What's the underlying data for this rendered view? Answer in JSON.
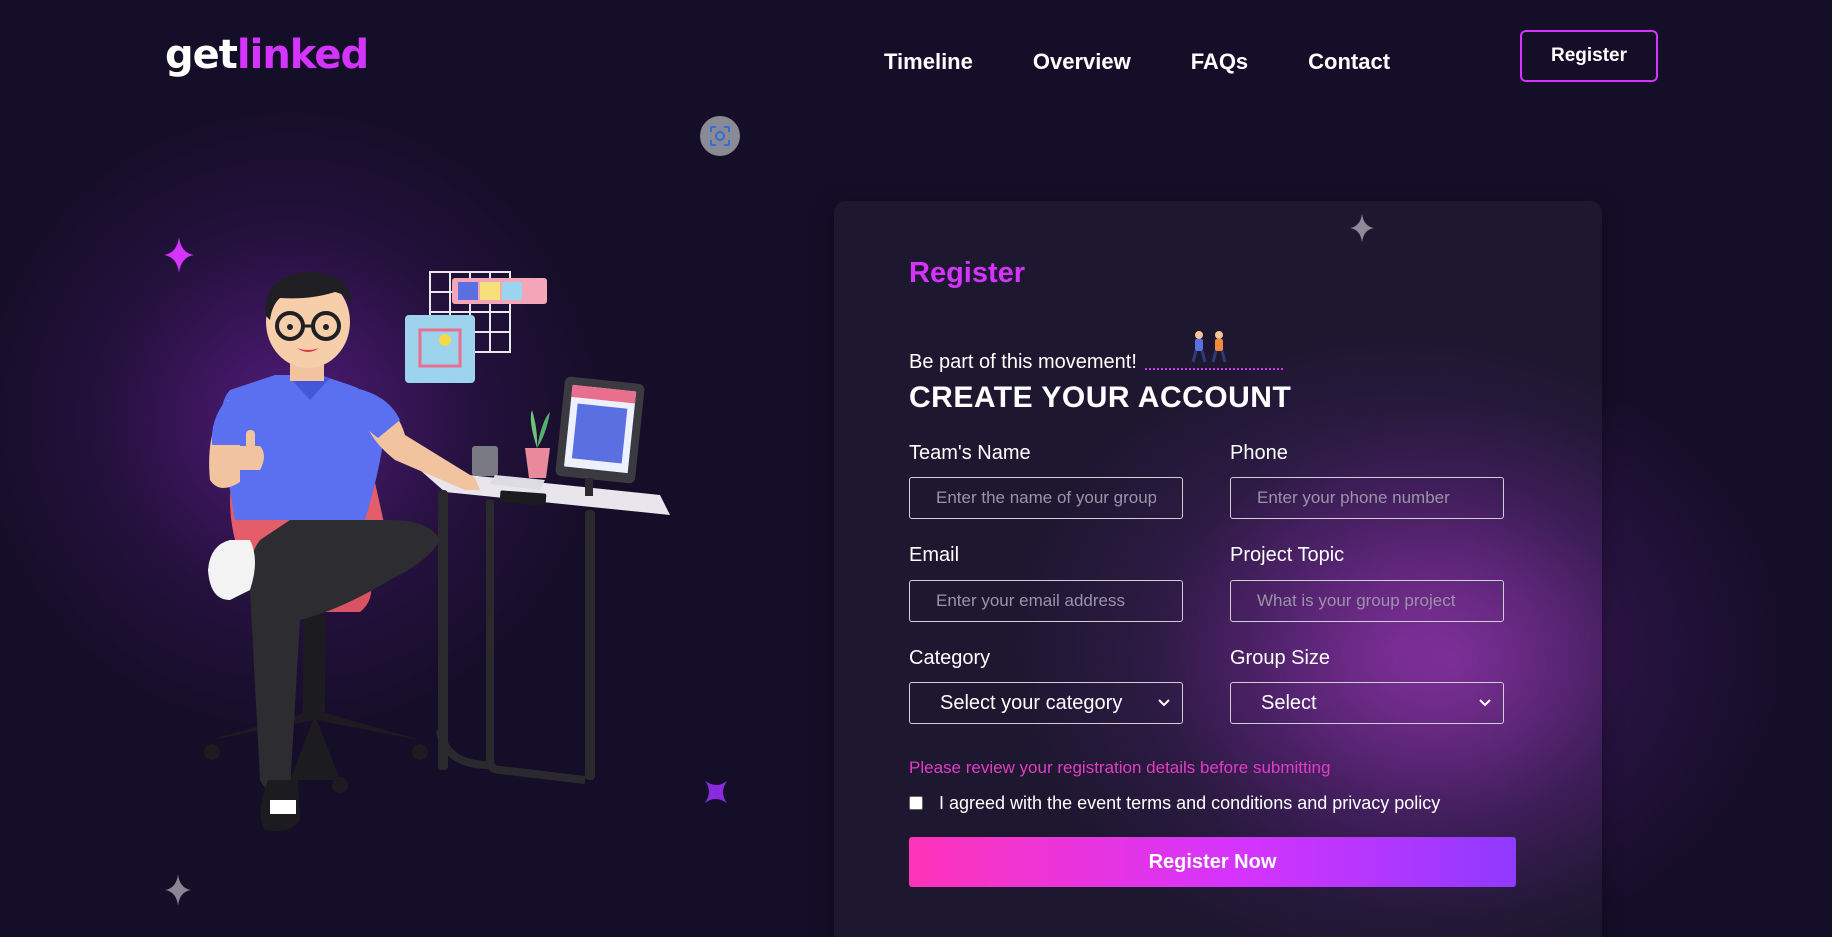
{
  "header": {
    "logo_get": "get",
    "logo_linked": "linked",
    "nav": [
      {
        "label": "Timeline"
      },
      {
        "label": "Overview"
      },
      {
        "label": "FAQs"
      },
      {
        "label": "Contact"
      }
    ],
    "register_label": "Register"
  },
  "form": {
    "title": "Register",
    "tagline": "Be part of this movement!",
    "subtitle": "CREATE YOUR ACCOUNT",
    "fields": {
      "team_name": {
        "label": "Team's Name",
        "placeholder": "Enter the name of your group"
      },
      "phone": {
        "label": "Phone",
        "placeholder": "Enter your phone number"
      },
      "email": {
        "label": "Email",
        "placeholder": "Enter your email address"
      },
      "project_topic": {
        "label": "Project Topic",
        "placeholder": "What is your group project"
      },
      "category": {
        "label": "Category",
        "selected": "Select your category"
      },
      "group_size": {
        "label": "Group Size",
        "selected": "Select"
      }
    },
    "warning": "Please review your registration details before submitting",
    "terms": "I agreed with the event terms and conditions and privacy policy",
    "submit_label": "Register Now"
  },
  "colors": {
    "accent": "#d434fe",
    "background": "#150e28",
    "warning": "#e23dc4",
    "button_gradient_start": "#fe34b9",
    "button_gradient_end": "#903aff"
  },
  "icons": [
    "sparkle-icon",
    "screen-capture-icon",
    "walking-people-icon",
    "chevron-down-icon"
  ]
}
